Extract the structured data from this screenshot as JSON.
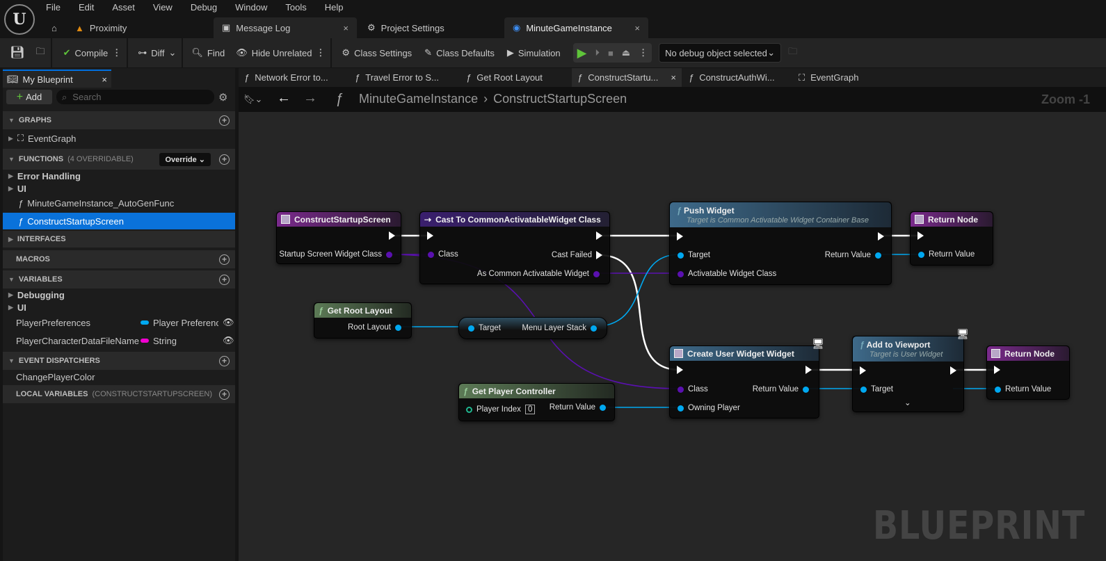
{
  "menu": [
    "File",
    "Edit",
    "Asset",
    "View",
    "Debug",
    "Window",
    "Tools",
    "Help"
  ],
  "file_tabs": [
    {
      "label": "Proximity"
    },
    {
      "label": "Message Log"
    },
    {
      "label": "Project Settings"
    },
    {
      "label": "MinuteGameInstance"
    }
  ],
  "toolbar": {
    "compile": "Compile",
    "diff": "Diff",
    "find": "Find",
    "hide_unrelated": "Hide Unrelated",
    "class_settings": "Class Settings",
    "class_defaults": "Class Defaults",
    "simulation": "Simulation",
    "debug_object": "No debug object selected"
  },
  "sidebar": {
    "tab": "My Blueprint",
    "add": "Add",
    "search_placeholder": "Search",
    "graphs": "GRAPHS",
    "event_graph": "EventGraph",
    "functions": "FUNCTIONS",
    "functions_sub": "(4 OVERRIDABLE)",
    "override": "Override",
    "function_items": [
      "Error Handling",
      "UI",
      "MinuteGameInstance_AutoGenFunc",
      "ConstructStartupScreen"
    ],
    "interfaces": "INTERFACES",
    "macros": "MACROS",
    "variables": "VARIABLES",
    "variable_groups": [
      "Debugging",
      "UI"
    ],
    "variables_list": [
      {
        "name": "PlayerPreferences",
        "type": "Player Preferenc",
        "color": "#00a8f0"
      },
      {
        "name": "PlayerCharacterDataFileName",
        "type": "String",
        "color": "#f000d0"
      }
    ],
    "event_dispatchers": "EVENT DISPATCHERS",
    "dispatcher_items": [
      "ChangePlayerColor"
    ],
    "local_variables": "LOCAL VARIABLES",
    "local_sub": "(CONSTRUCTSTARTUPSCREEN)"
  },
  "graph_tabs": [
    "Network Error to...",
    "Travel Error to S...",
    "Get Root Layout",
    "ConstructStartu...",
    "ConstructAuthWi...",
    "EventGraph"
  ],
  "breadcrumb": {
    "root": "MinuteGameInstance",
    "current": "ConstructStartupScreen",
    "zoom": "Zoom -1"
  },
  "watermark": "BLUEPRINT",
  "nodes": {
    "entry": {
      "title": "ConstructStartupScreen",
      "pin": "Startup Screen Widget Class"
    },
    "cast": {
      "title": "Cast To CommonActivatableWidget Class",
      "class": "Class",
      "failed": "Cast Failed",
      "as": "As Common Activatable Widget"
    },
    "push": {
      "title": "Push Widget",
      "subtitle": "Target is Common Activatable Widget Container Base",
      "target": "Target",
      "awc": "Activatable Widget Class",
      "ret": "Return Value"
    },
    "ret1": {
      "title": "Return Node",
      "ret": "Return Value"
    },
    "root": {
      "title": "Get Root Layout",
      "out": "Root Layout"
    },
    "mls": {
      "target": "Target",
      "out": "Menu Layer Stack"
    },
    "gpc": {
      "title": "Get Player Controller",
      "index_label": "Player Index",
      "index_value": "0",
      "ret": "Return Value"
    },
    "cuw": {
      "title": "Create User Widget Widget",
      "class": "Class",
      "owner": "Owning Player",
      "ret": "Return Value"
    },
    "atv": {
      "title": "Add to Viewport",
      "subtitle": "Target is User Widget",
      "target": "Target"
    },
    "ret2": {
      "title": "Return Node",
      "ret": "Return Value"
    }
  },
  "colors": {
    "exec": "#ffffff",
    "class_pin": "#5a10b0",
    "object_pin": "#00a8f0",
    "selected": "#0a72da",
    "play": "#5fc43a"
  }
}
